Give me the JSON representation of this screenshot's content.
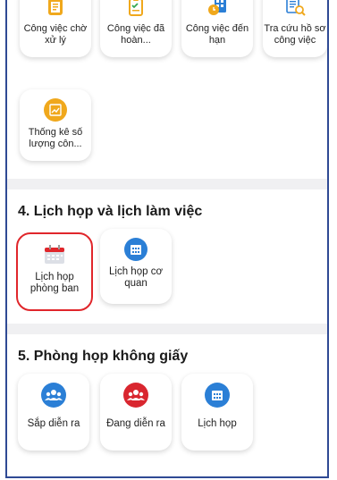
{
  "work_items": [
    {
      "label": "Công việc chờ xử lý",
      "icon": "clipboard-icon",
      "color": "#f0a81c"
    },
    {
      "label": "Công việc đã hoàn...",
      "icon": "clipboard-check-icon",
      "color": "#f0a81c"
    },
    {
      "label": "Công việc đến hạn",
      "icon": "clock-grid-icon",
      "color": "#2b7fd6"
    },
    {
      "label": "Tra cứu hồ sơ công việc",
      "icon": "document-search-icon",
      "color": "#2b7fd6"
    },
    {
      "label": "Thống kê số lượng côn...",
      "icon": "chart-icon",
      "color": "#f0a81c"
    }
  ],
  "section4": {
    "title": "4. Lịch họp và lịch làm việc",
    "items": [
      {
        "label": "Lịch họp phòng ban",
        "icon": "calendar-icon",
        "color": "#e0262b"
      },
      {
        "label": "Lịch họp cơ quan",
        "icon": "calendar-icon",
        "color": "#2b7fd6"
      }
    ]
  },
  "section5": {
    "title": "5. Phòng họp không giấy",
    "items": [
      {
        "label": "Sắp diễn ra",
        "icon": "meeting-group-icon",
        "color": "#2b7fd6"
      },
      {
        "label": "Đang diễn ra",
        "icon": "meeting-group-icon",
        "color": "#d9262f"
      },
      {
        "label": "Lịch họp",
        "icon": "calendar-icon",
        "color": "#2b7fd6"
      }
    ]
  }
}
